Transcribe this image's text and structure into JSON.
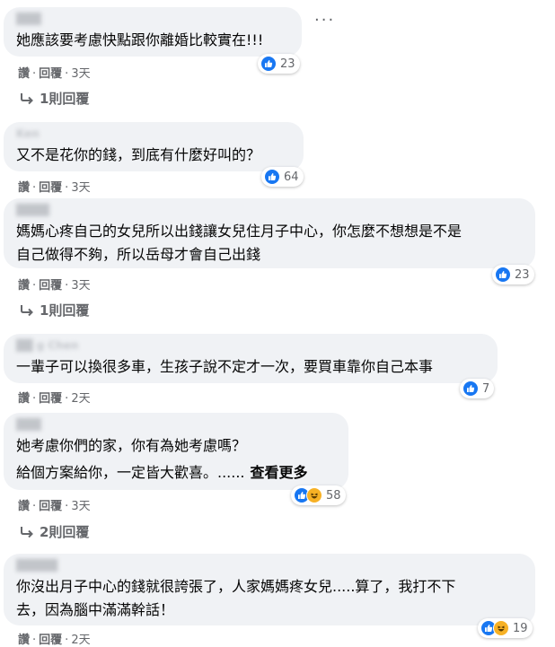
{
  "ui": {
    "like_label": "讚",
    "reply_label": "回覆",
    "separator": "·",
    "more_options": "···"
  },
  "comments": [
    {
      "author": "███",
      "lines": [
        "她應該要考慮快點跟你離婚比較實在!!!"
      ],
      "see_more": "",
      "reactions": {
        "count": "23",
        "haha": false
      },
      "time": "3天",
      "replies": "1則回覆"
    },
    {
      "author": "Ken",
      "lines": [
        "又不是花你的錢，到底有什麼好叫的？"
      ],
      "see_more": "",
      "reactions": {
        "count": "64",
        "haha": false
      },
      "time": "3天",
      "replies": ""
    },
    {
      "author": "████",
      "lines": [
        "媽媽心疼自己的女兒所以出錢讓女兒住月子中心，你怎麼不想想是不是",
        "自己做得不夠，所以岳母才會自己出錢"
      ],
      "see_more": "",
      "reactions": {
        "count": "23",
        "haha": false
      },
      "time": "3天",
      "replies": "1則回覆"
    },
    {
      "author": "██ g Chen",
      "lines": [
        "一輩子可以換很多車，生孩子說不定才一次，要買車靠你自己本事"
      ],
      "see_more": "",
      "reactions": {
        "count": "7",
        "haha": false
      },
      "time": "2天",
      "replies": ""
    },
    {
      "author": "███",
      "lines": [
        "她考慮你們的家，你有為她考慮嗎？",
        "給個方案給你，一定皆大歡喜。......"
      ],
      "see_more": "查看更多",
      "reactions": {
        "count": "58",
        "haha": true
      },
      "time": "3天",
      "replies": "2則回覆"
    },
    {
      "author": "█████",
      "lines": [
        "你沒出月子中心的錢就很誇張了，人家媽媽疼女兒.....算了，我打不下",
        "去，因為腦中滿滿幹話！"
      ],
      "see_more": "",
      "reactions": {
        "count": "19",
        "haha": true
      },
      "time": "2天",
      "replies": ""
    }
  ]
}
